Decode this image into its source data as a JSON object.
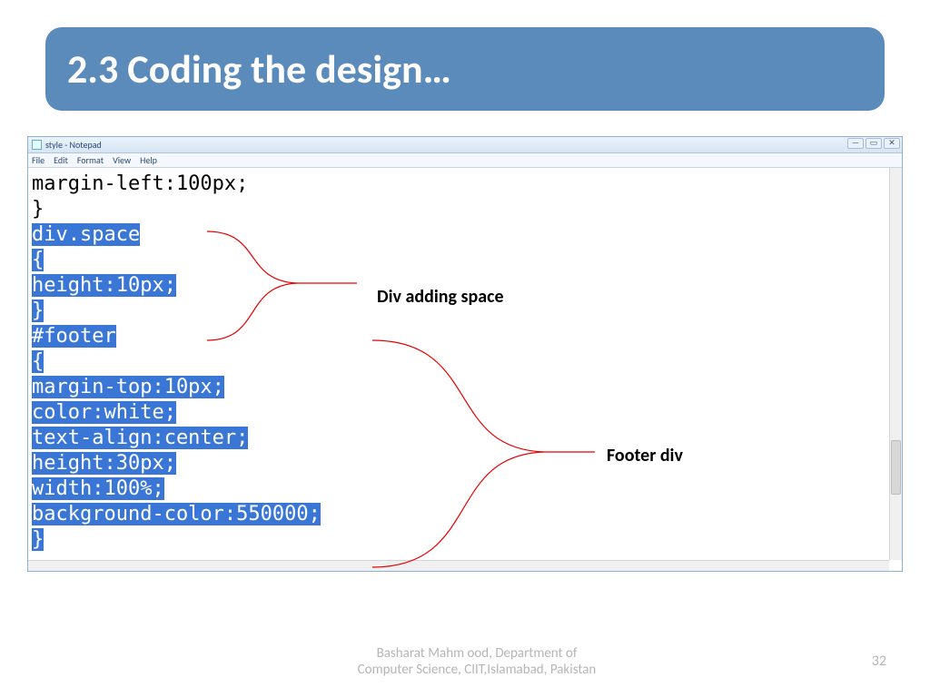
{
  "title": "2.3 Coding the design…",
  "notepad": {
    "window_title": "style - Notepad",
    "menus": [
      "File",
      "Edit",
      "Format",
      "View",
      "Help"
    ],
    "win_controls": {
      "min": "—",
      "max": "▭",
      "close": "✕"
    },
    "code_plain": "margin-left:100px;\n}",
    "code_selected": [
      "div.space",
      "{",
      "height:10px;",
      "}",
      "#footer",
      "{",
      "margin-top:10px;",
      "color:white;",
      "text-align:center;",
      "height:30px;",
      "width:100%;",
      "background-color:550000;",
      "}"
    ]
  },
  "annotations": {
    "space": "Div adding space",
    "footer": "Footer div"
  },
  "footer": {
    "author": "Basharat Mahm ood, Department of",
    "affiliation": "Computer Science, CIIT,Islamabad, Pakistan",
    "page": "32"
  }
}
